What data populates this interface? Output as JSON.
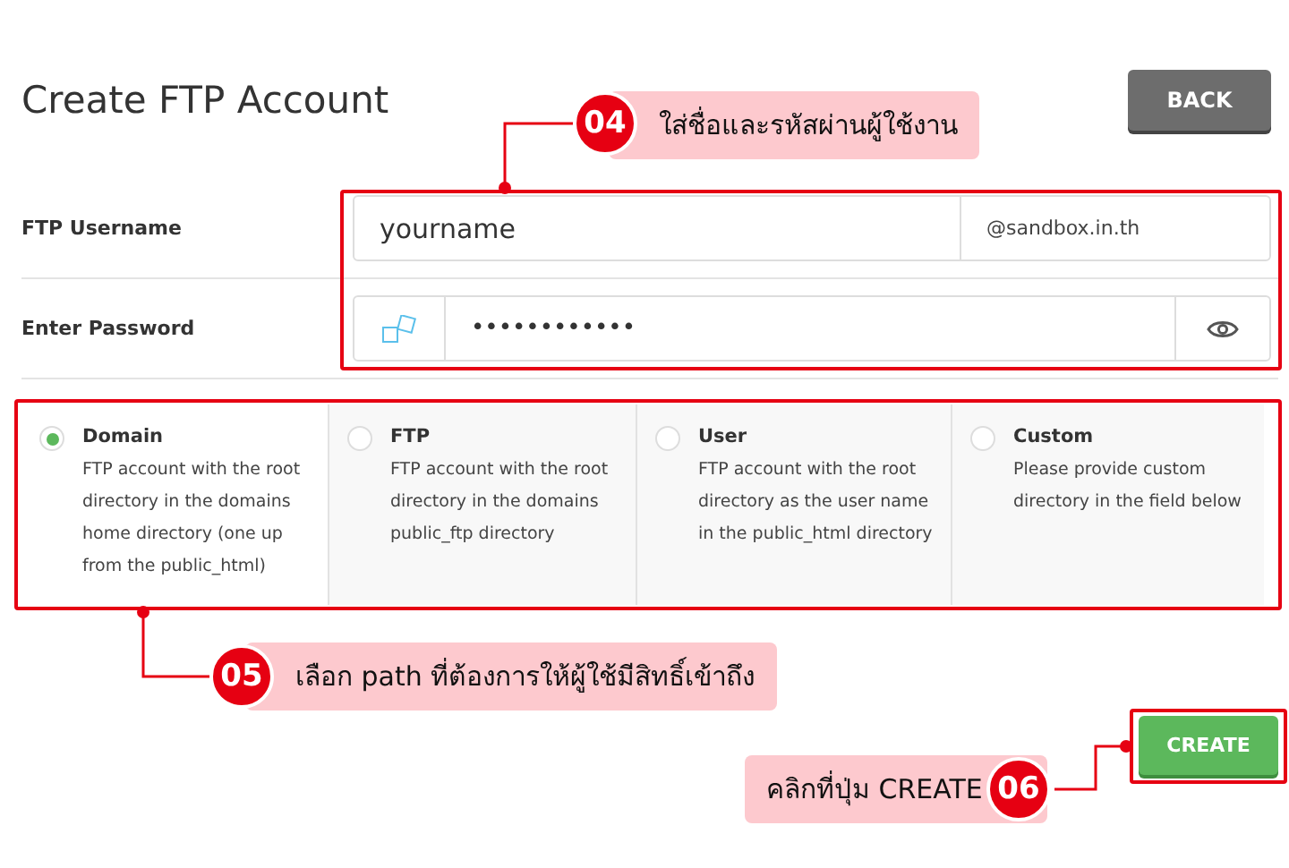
{
  "page": {
    "title": "Create FTP Account"
  },
  "back_button": "BACK",
  "username": {
    "label": "FTP Username",
    "value": "yourname",
    "suffix": "@sandbox.in.th"
  },
  "password": {
    "label": "Enter Password",
    "value": "••••••••••••"
  },
  "directory_options": [
    {
      "title": "Domain",
      "description": "FTP account with the root directory in the domains home directory (one up from the public_html)",
      "selected": true
    },
    {
      "title": "FTP",
      "description": "FTP account with the root directory in the domains public_ftp directory",
      "selected": false
    },
    {
      "title": "User",
      "description": "FTP account with the root directory as the user name in the public_html directory",
      "selected": false
    },
    {
      "title": "Custom",
      "description": "Please provide custom directory in the field below",
      "selected": false
    }
  ],
  "create_button": "CREATE",
  "annotations": [
    {
      "number": "04",
      "text": "ใส่ชื่อและรหัสผ่านผู้ใช้งาน"
    },
    {
      "number": "05",
      "text": "เลือก path ที่ต้องการให้ผู้ใช้มีสิทธิ์เข้าถึง"
    },
    {
      "number": "06",
      "text": "คลิกที่ปุ่ม CREATE"
    }
  ]
}
